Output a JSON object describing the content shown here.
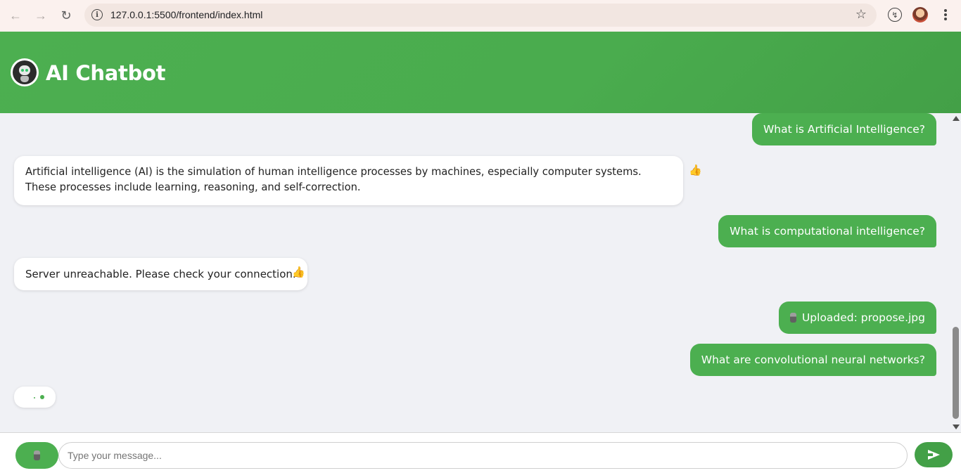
{
  "browser": {
    "url": "127.0.0.1:5500/frontend/index.html",
    "icons": [
      "back-icon",
      "forward-icon",
      "reload-icon",
      "site-info-icon",
      "bookmark-star-icon",
      "extension-icon",
      "profile-avatar",
      "menu-icon"
    ]
  },
  "header": {
    "title": "AI Chatbot",
    "avatar_icon": "robot-icon"
  },
  "messages": [
    {
      "role": "user",
      "text": "What is Artificial Intelligence?"
    },
    {
      "role": "bot",
      "text": "Artificial intelligence (AI) is the simulation of human intelligence processes by machines, especially computer systems. These processes include learning, reasoning, and self-correction.",
      "reaction": "👍"
    },
    {
      "role": "user",
      "text": "What is computational intelligence?"
    },
    {
      "role": "bot",
      "text": "Server unreachable. Please check your connection.",
      "reaction": "👍"
    },
    {
      "role": "user",
      "text": "Uploaded: propose.jpg",
      "icon": "upload-icon"
    },
    {
      "role": "user",
      "text": "What are convolutional neural networks?"
    }
  ],
  "typing_indicator": true,
  "input": {
    "placeholder": "Type your message...",
    "value": ""
  },
  "colors": {
    "accent": "#4caf50",
    "header": "#4caf50",
    "chat_bg": "#f0f1f5",
    "bot_bubble": "#ffffff",
    "user_text": "#ffffff"
  }
}
